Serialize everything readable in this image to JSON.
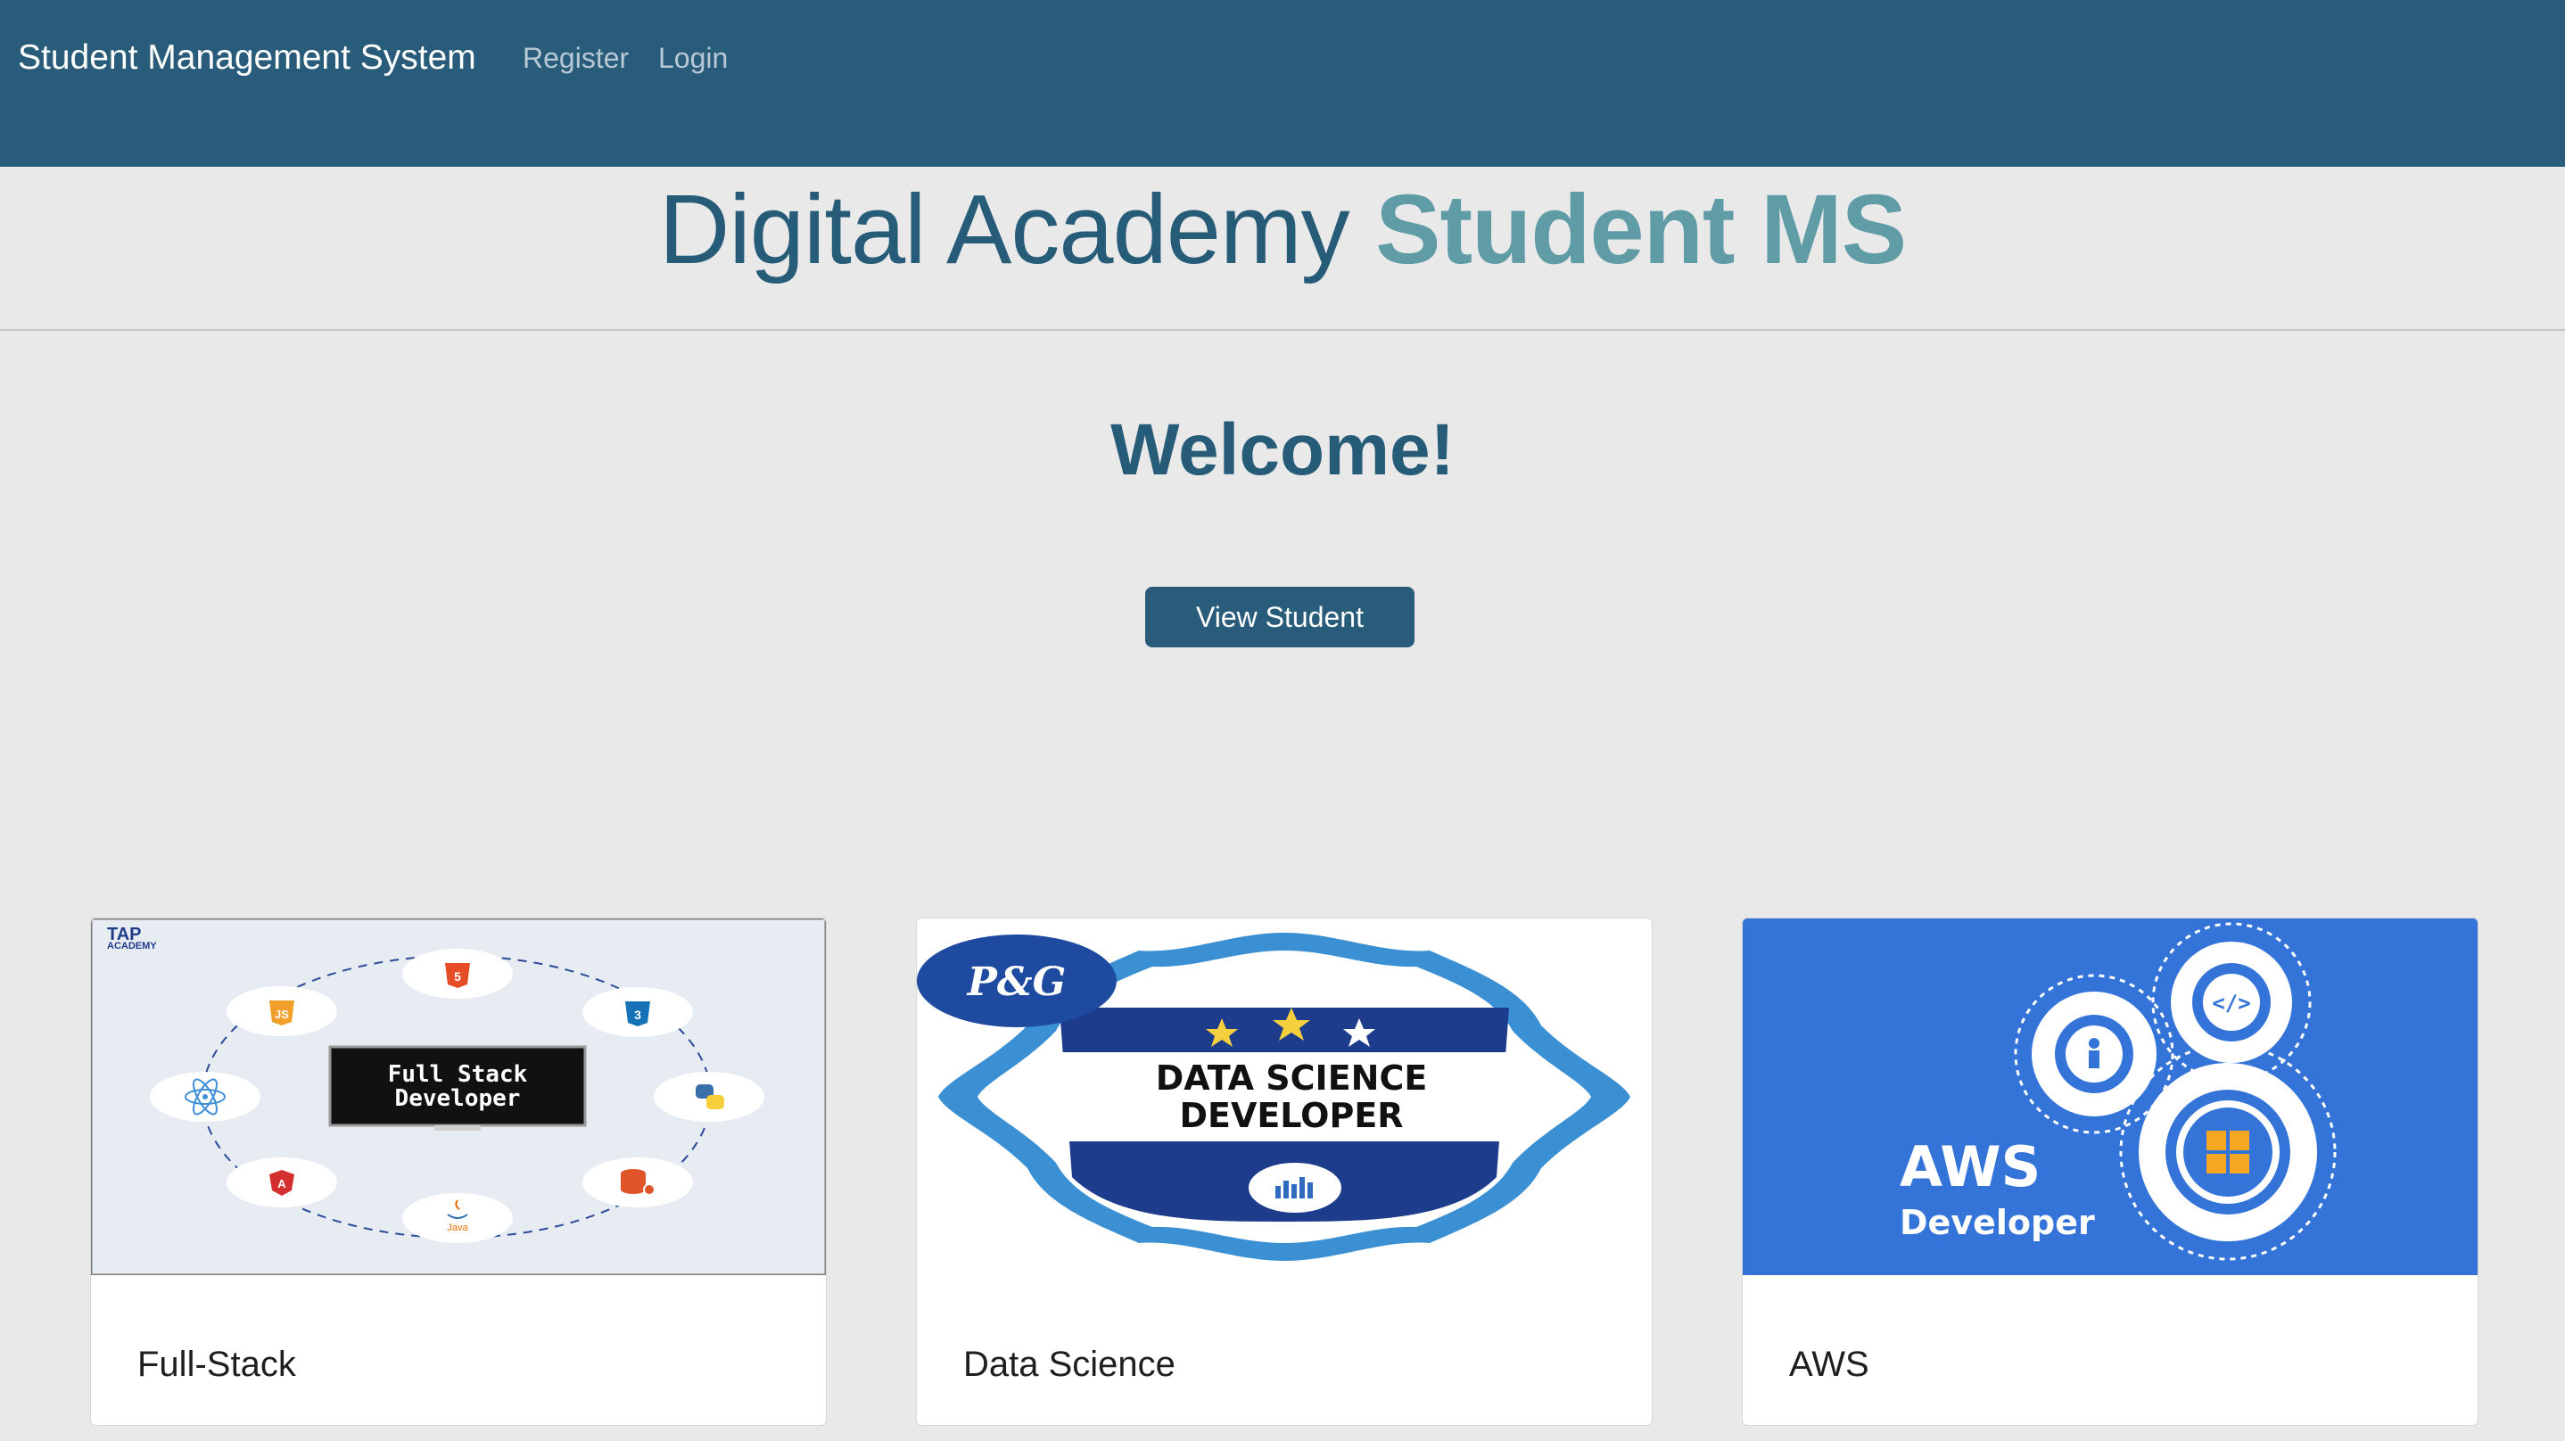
{
  "navbar": {
    "brand": "Student Management System",
    "links": [
      "Register",
      "Login"
    ]
  },
  "hero": {
    "title_part1": "Digital Academy ",
    "title_part2": "Student MS"
  },
  "welcome": "Welcome!",
  "view_button": "View Student",
  "cards": [
    {
      "title": "Full-Stack",
      "image_text": {
        "logo_line1": "TAP",
        "logo_line2": "ACADEMY",
        "badge_line1": "Full Stack",
        "badge_line2": "Developer",
        "java": "Java"
      }
    },
    {
      "title": "Data Science",
      "image_text": {
        "logo": "P&G",
        "line1": "DATA SCIENCE",
        "line2": "DEVELOPER"
      }
    },
    {
      "title": "AWS",
      "image_text": {
        "line1": "AWS",
        "line2": "Developer",
        "code_glyph": "</>"
      }
    }
  ],
  "colors": {
    "navbar": "#285c7a",
    "title_dark": "#275c79",
    "title_accent": "#5f9ca6",
    "aws_blue": "#3474d8"
  }
}
